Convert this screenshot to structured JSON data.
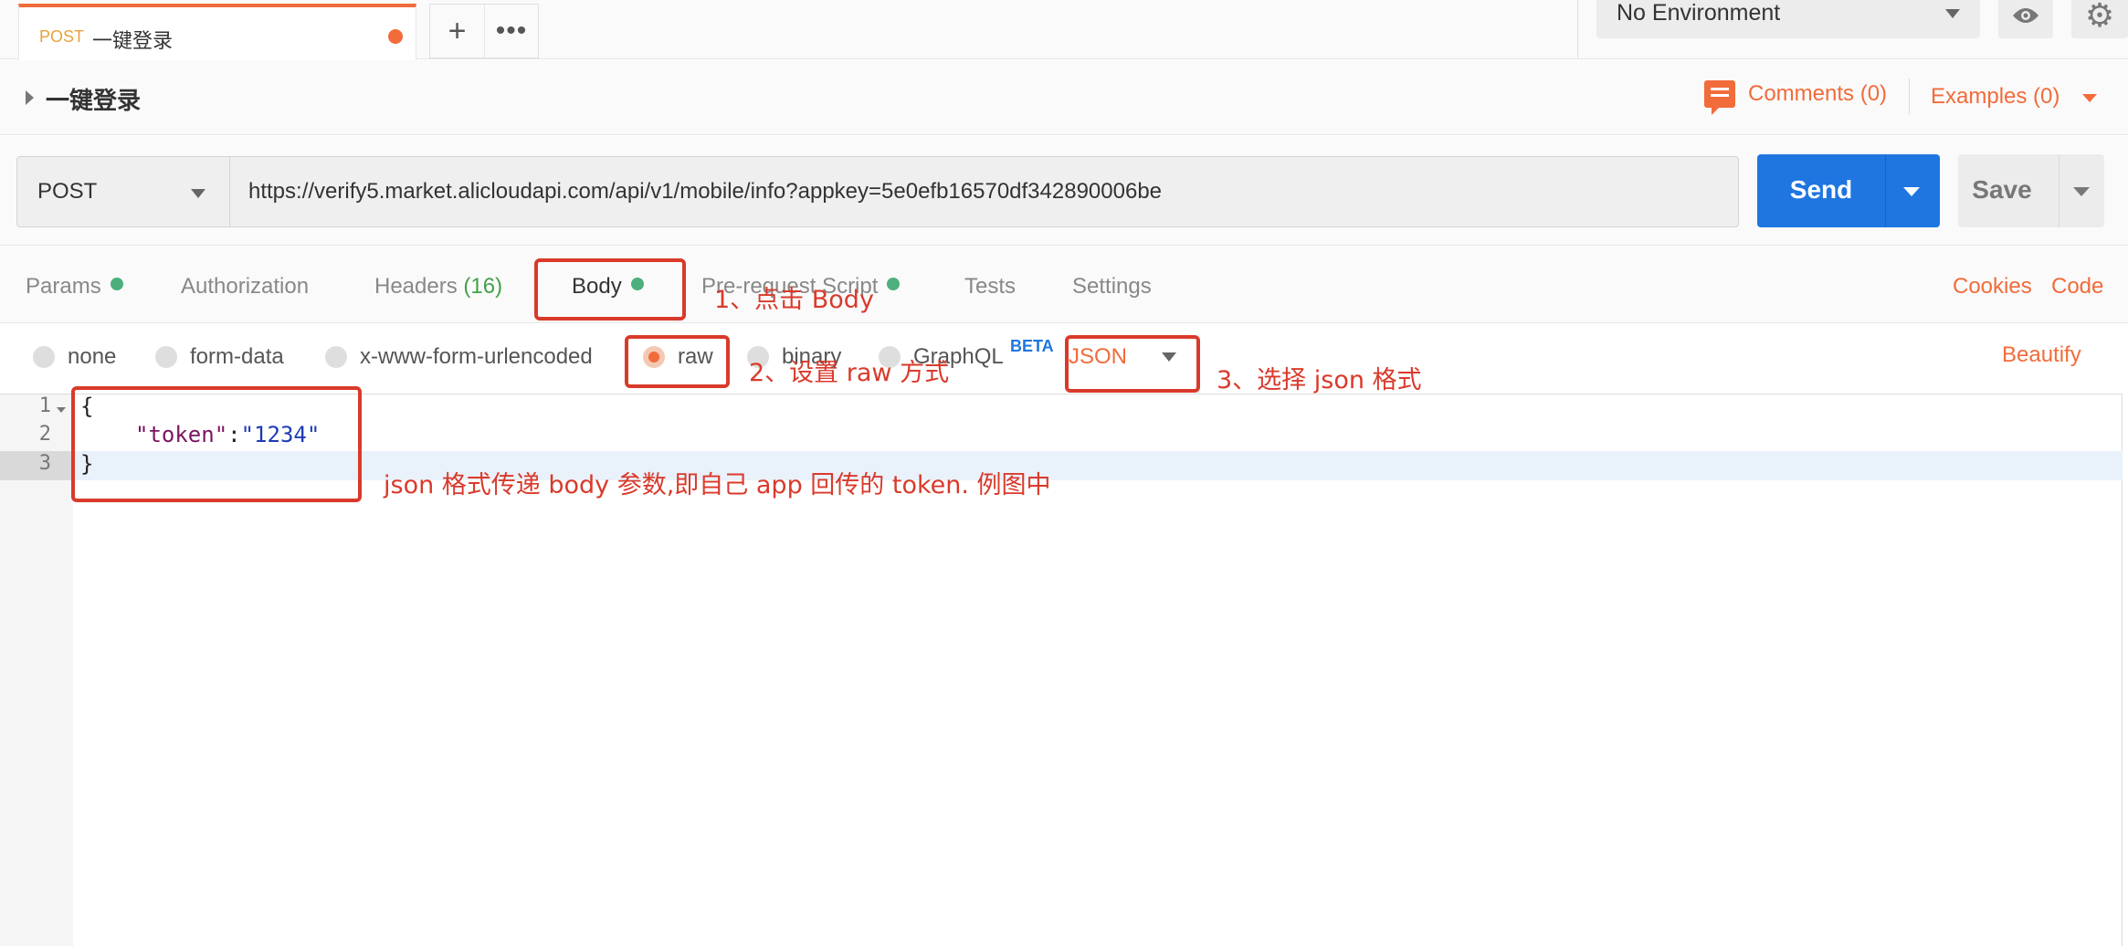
{
  "tab": {
    "method": "POST",
    "title": "一键登录"
  },
  "tabbar": {
    "new_tab": "+",
    "more": "•••"
  },
  "environment": {
    "selected": "No Environment"
  },
  "request_name": "一键登录",
  "header_links": {
    "comments": "Comments (0)",
    "examples": "Examples (0)"
  },
  "request": {
    "method": "POST",
    "url": "https://verify5.market.alicloudapi.com/api/v1/mobile/info?appkey=5e0efb16570df342890006be",
    "send_label": "Send",
    "save_label": "Save"
  },
  "req_tabs": {
    "params": "Params",
    "authorization": "Authorization",
    "headers": "Headers",
    "headers_count": "(16)",
    "body": "Body",
    "prerequest": "Pre-request Script",
    "tests": "Tests",
    "settings": "Settings",
    "cookies": "Cookies",
    "code": "Code"
  },
  "body_types": {
    "none": "none",
    "form_data": "form-data",
    "urlencoded": "x-www-form-urlencoded",
    "raw": "raw",
    "binary": "binary",
    "graphql": "GraphQL",
    "beta": "BETA",
    "selected": "raw"
  },
  "format": "JSON",
  "beautify": "Beautify",
  "editor": {
    "line_numbers": [
      "1",
      "2",
      "3"
    ],
    "line1": "{",
    "key": "\"token\"",
    "colon": ":",
    "value": "\"1234\"",
    "line3": "}"
  },
  "annotations": {
    "step1": "1、点击 Body",
    "step2": "2、设置 raw 方式",
    "step3": "3、选择 json 格式",
    "body_note": "json 格式传递 body 参数,即自己 app 回传的 token. 例图中"
  },
  "colors": {
    "accent": "#f26b3a",
    "send": "#1f76e0",
    "annotation": "#d93a2b",
    "status_dot": "#4caf7d"
  }
}
